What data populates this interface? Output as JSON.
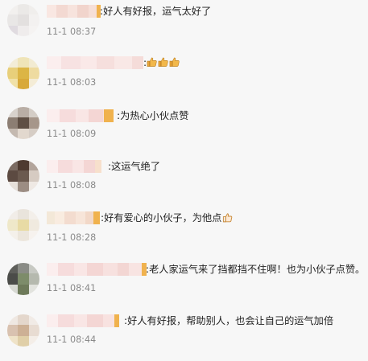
{
  "comments": [
    {
      "text": ":好人有好报，运气太好了",
      "time": "11-1 08:37"
    },
    {
      "text": ":",
      "time": "11-1 08:03",
      "reaction_icon": "thumbs-up-icon",
      "reaction_count": 3
    },
    {
      "text": ":为热心小伙点赞",
      "time": "11-1 08:09"
    },
    {
      "text": ":这运气绝了",
      "time": "11-1 08:08"
    },
    {
      "text": ":好有爱心的小伙子，为他点",
      "time": "11-1 08:28",
      "trailing_icon": "like-icon"
    },
    {
      "text": ":老人家运气来了挡都挡不住啊！也为小伙子点赞。",
      "time": "11-1 08:41"
    },
    {
      "text": ":好人有好报，帮助别人，也会让自己的运气加倍",
      "time": "11-1 08:44"
    }
  ],
  "colors": {
    "background": "#f7f7f7",
    "text": "#222222",
    "timestamp": "#8a8a8a",
    "badge": "#f0b24e",
    "thumb": "#f2b84b"
  }
}
